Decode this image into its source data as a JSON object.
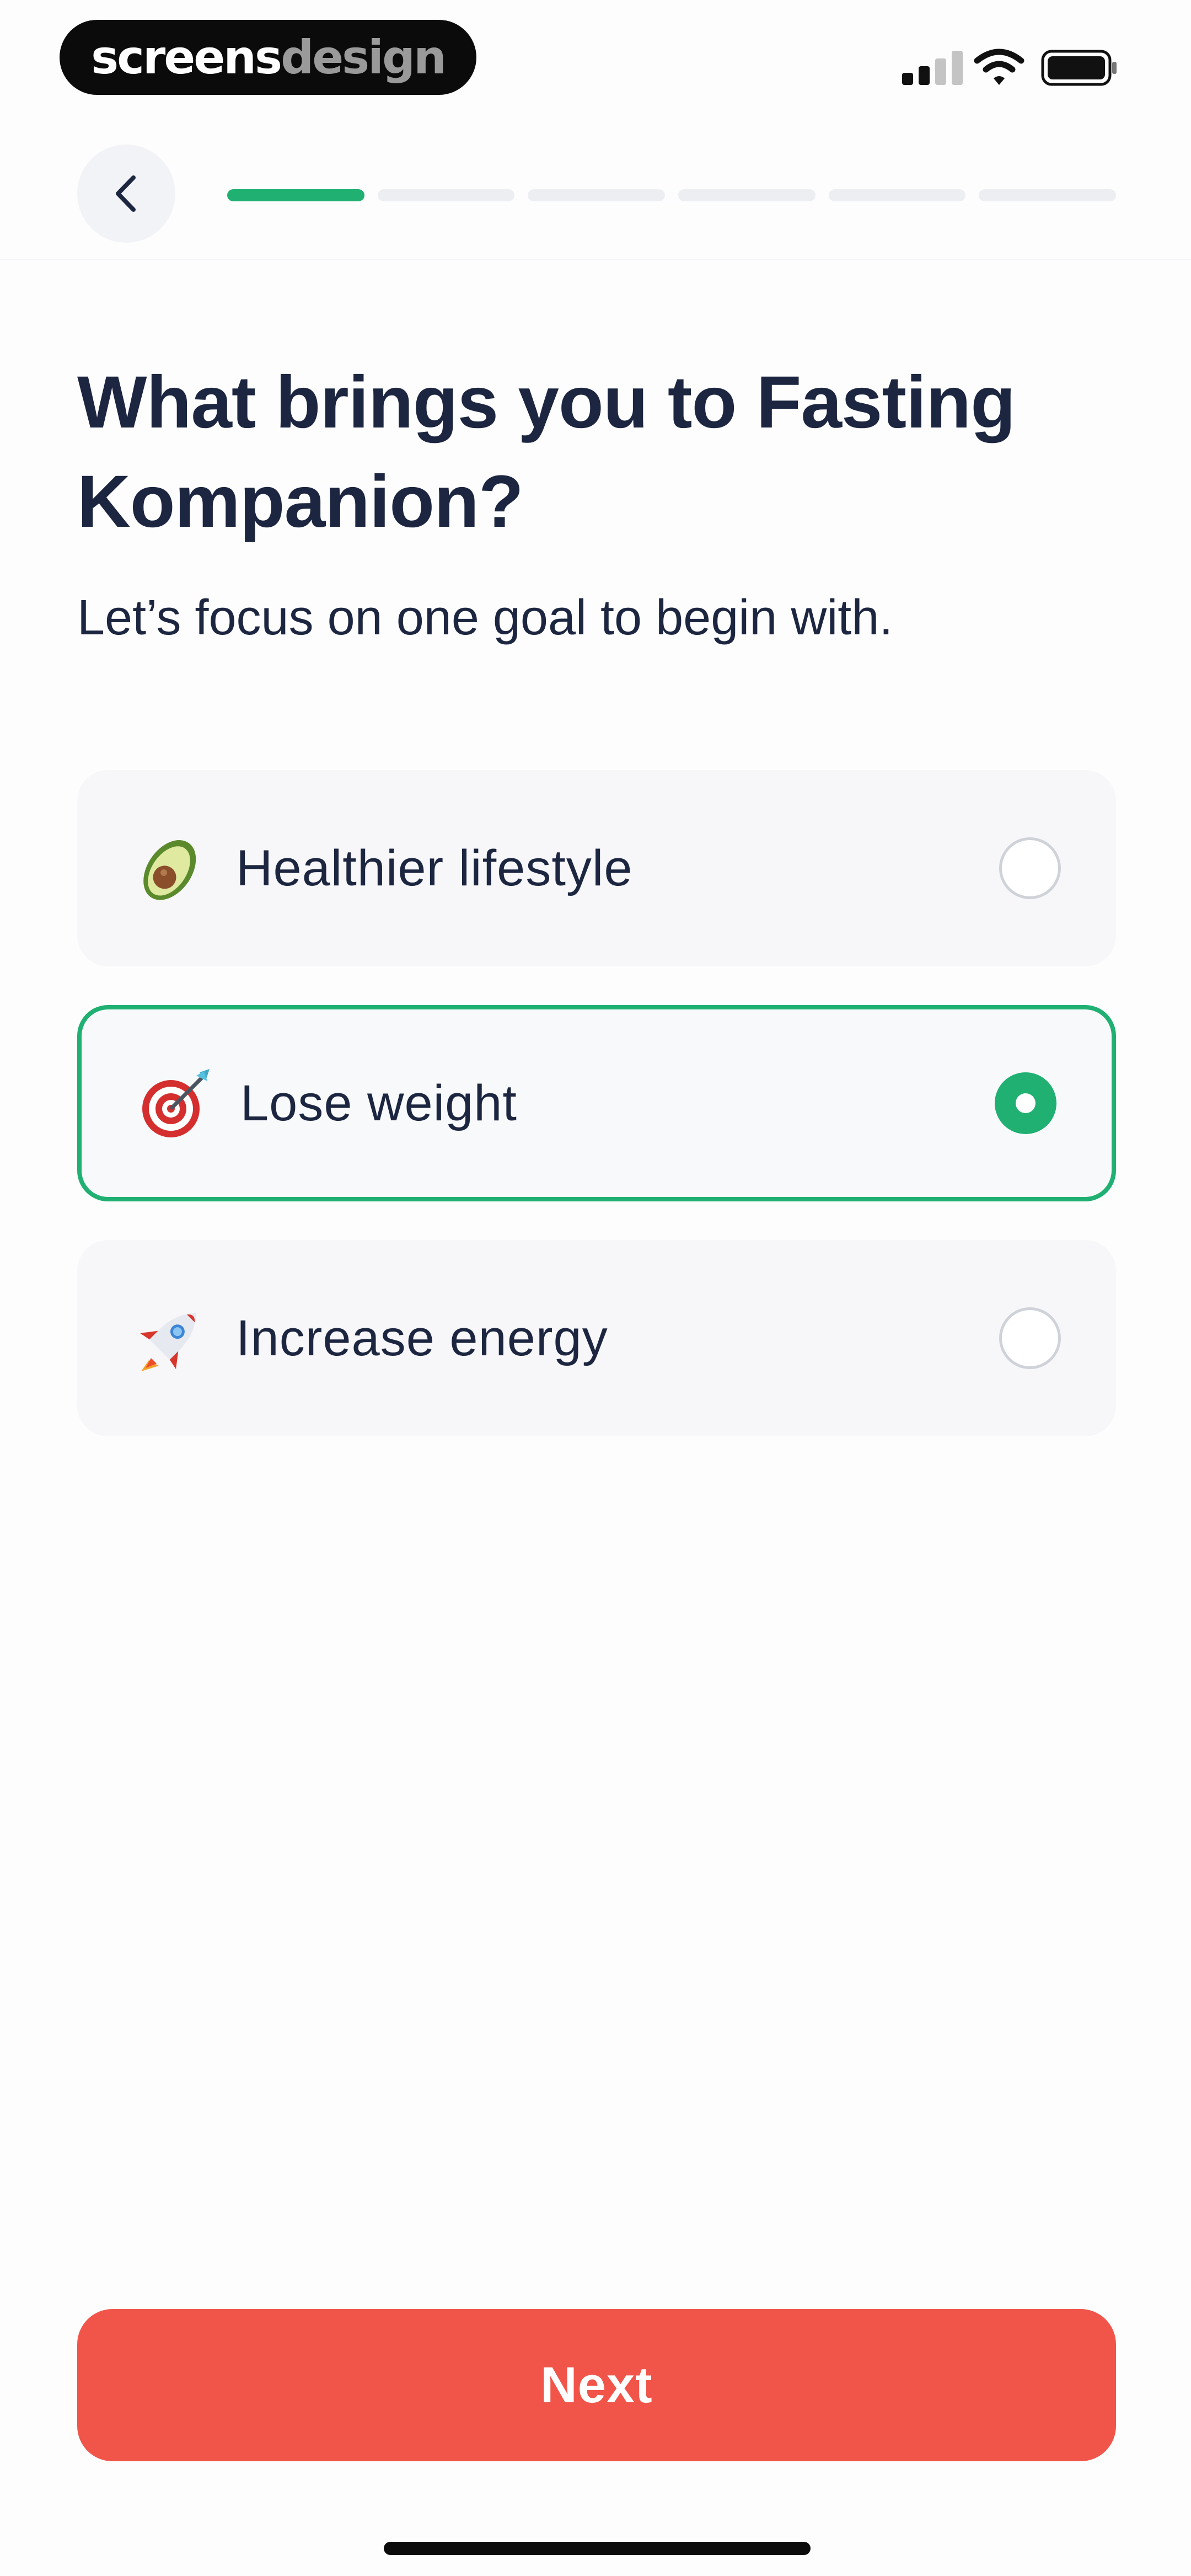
{
  "status_bar": {
    "brand_part1": "screens",
    "brand_part2": "design",
    "icons": [
      "signal-icon",
      "wifi-icon",
      "battery-icon"
    ]
  },
  "nav": {
    "back_icon": "chevron-left-icon",
    "progress_steps_total": 6,
    "progress_steps_done": 1
  },
  "question": {
    "title": "What brings you to Fasting Kompanion?",
    "subtitle": "Let’s focus on one goal to begin with."
  },
  "options": [
    {
      "label": "Healthier lifestyle",
      "icon": "avocado-icon",
      "selected": false
    },
    {
      "label": "Lose weight",
      "icon": "target-icon",
      "selected": true
    },
    {
      "label": "Increase energy",
      "icon": "rocket-icon",
      "selected": false
    }
  ],
  "footer": {
    "next_label": "Next"
  },
  "colors": {
    "accent_green": "#1fb072",
    "button_red": "#f1554a",
    "text_dark": "#1c2640",
    "card_bg": "#f7f7fa"
  }
}
